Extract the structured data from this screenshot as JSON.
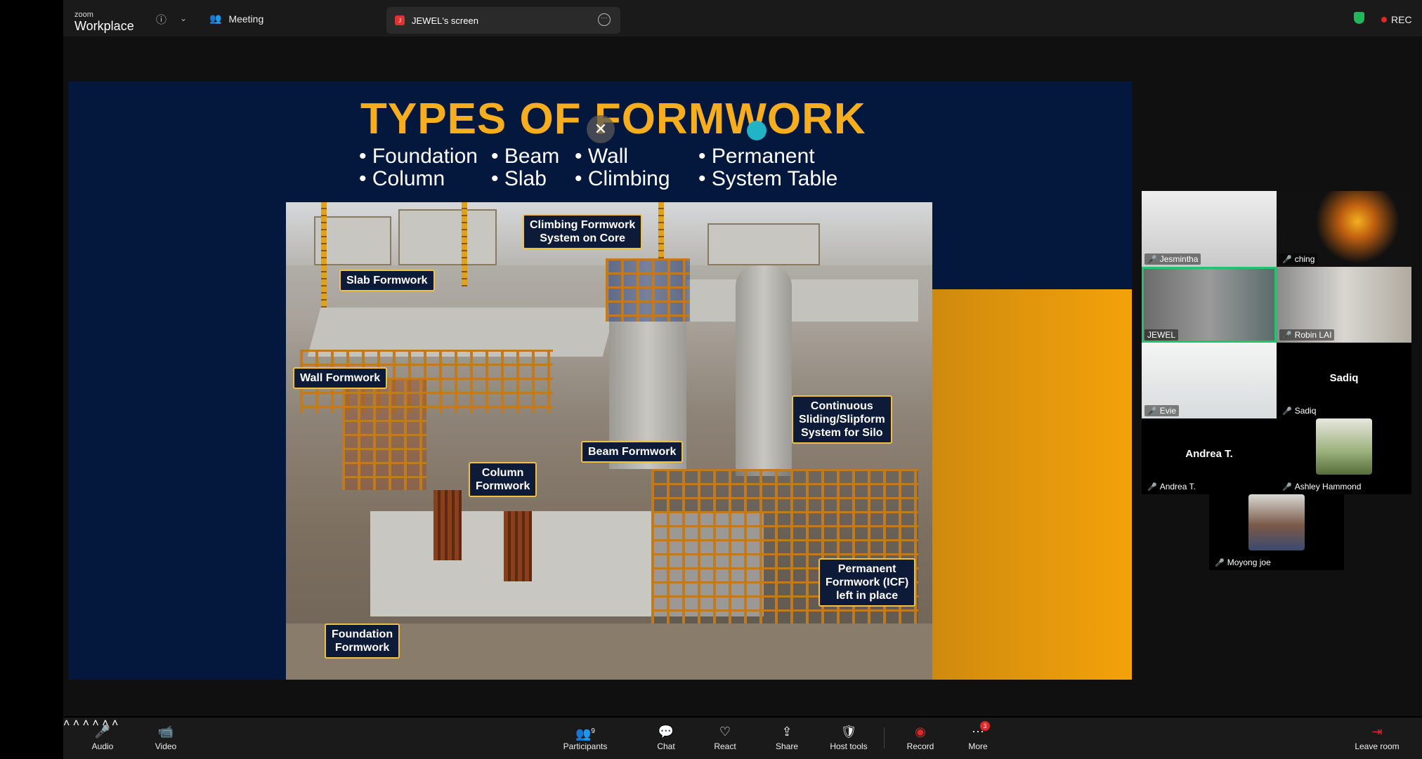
{
  "app": {
    "brand_small": "zoom",
    "brand_big": "Workplace"
  },
  "topbar": {
    "meeting_label": "Meeting",
    "screen_tab_label": "JEWEL's screen",
    "screen_tab_initial": "J",
    "rec_label": "REC"
  },
  "slide": {
    "title": "TYPES OF FORMWORK",
    "bullets": [
      "• Foundation",
      "• Beam",
      "• Wall",
      "• Permanent",
      "• Column",
      "• Slab",
      "• Climbing",
      "• System Table"
    ],
    "close_symbol": "✕",
    "callouts": [
      "Climbing Formwork\nSystem on Core",
      "Slab Formwork",
      "Wall Formwork",
      "Continuous\nSliding/Slipform\nSystem for Silo",
      "Beam Formwork",
      "Column\nFormwork",
      "Permanent\nFormwork (ICF)\nleft in place",
      "Foundation\nFormwork"
    ]
  },
  "participants": [
    {
      "name": "Jesmintha"
    },
    {
      "name": "ching"
    },
    {
      "name": "JEWEL"
    },
    {
      "name": "Robin LAI"
    },
    {
      "name": "Evie"
    },
    {
      "name": "Sadiq",
      "center": "Sadiq"
    },
    {
      "name": "Andrea T.",
      "center": "Andrea T."
    },
    {
      "name": "Ashley Hammond"
    },
    {
      "name": "Moyong joe"
    }
  ],
  "toolbar": {
    "audio": "Audio",
    "video": "Video",
    "participants": "Participants",
    "participants_count": "9",
    "chat": "Chat",
    "react": "React",
    "share": "Share",
    "host_tools": "Host tools",
    "record": "Record",
    "more": "More",
    "more_badge": "3",
    "leave": "Leave room"
  },
  "colors": {
    "accent_green": "#22c36a",
    "rec_red": "#e02828",
    "slide_title": "#f6ae1f",
    "slide_bg": "#04173d"
  },
  "icons": [
    "info-icon",
    "chevron-down-icon",
    "participants-icon",
    "more-icon",
    "shield-icon",
    "annotate-icon",
    "layout-icon",
    "mic-off-icon",
    "video-icon",
    "chat-icon",
    "react-icon",
    "share-icon",
    "host-tools-icon",
    "record-icon",
    "leave-icon"
  ]
}
